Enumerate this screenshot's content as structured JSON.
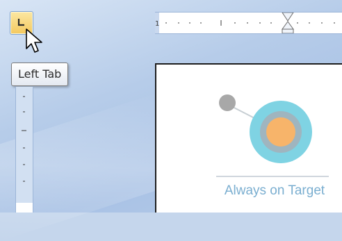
{
  "tab_selector": {
    "icon": "left-tab-stop-icon",
    "state": "hover"
  },
  "tooltip": {
    "text": "Left Tab"
  },
  "horizontal_ruler": {
    "number_label": "1"
  },
  "document": {
    "logo": {
      "icon": "target-logo-icon"
    },
    "logo_text": "Always on Target"
  },
  "colors": {
    "workspace": "#b6cce9",
    "tab_highlight": "#f4c95f",
    "target_outer": "#7fd3e3",
    "target_ring": "#9fb5bf",
    "target_center": "#f7b46a",
    "logo_text": "#7aaed0"
  }
}
